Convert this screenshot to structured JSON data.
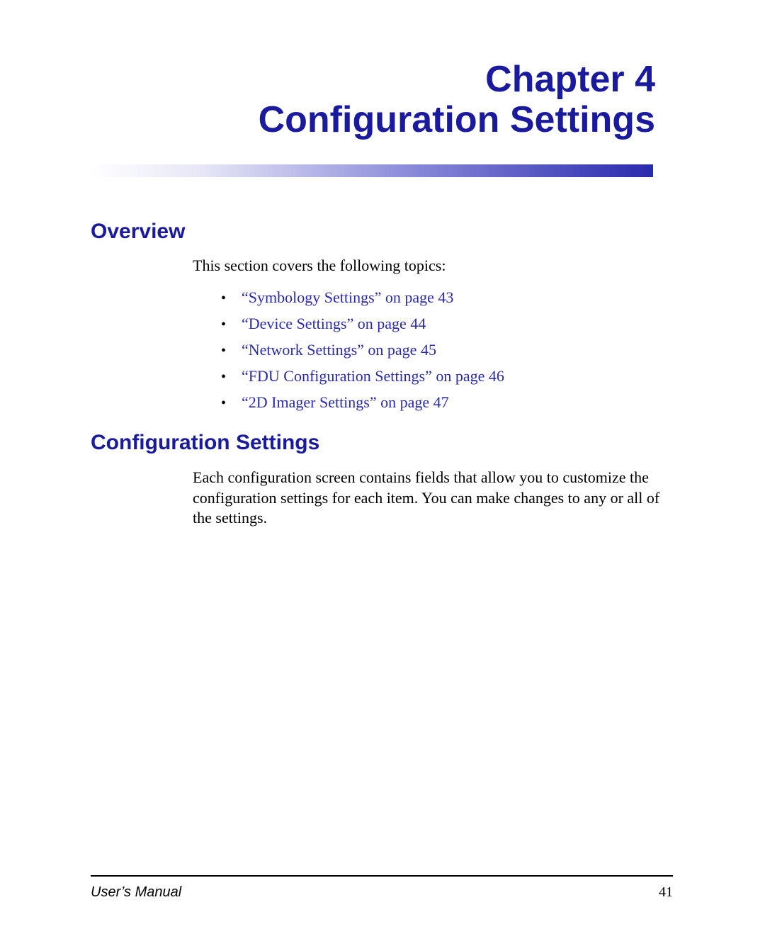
{
  "chapter": {
    "line1": "Chapter 4",
    "line2": "Configuration Settings"
  },
  "overview": {
    "heading": "Overview",
    "intro": "This section covers the following topics:",
    "topics": [
      "“Symbology Settings” on page 43",
      "“Device Settings” on page 44",
      "“Network Settings” on page 45",
      "“FDU Configuration Settings” on page 46",
      "“2D Imager Settings” on page 47"
    ]
  },
  "config": {
    "heading": "Configuration Settings",
    "body": "Each configuration screen contains fields that allow you to customize the configuration settings for each item. You can make changes to any or all of the settings."
  },
  "footer": {
    "left": "User’s Manual",
    "page": "41"
  }
}
